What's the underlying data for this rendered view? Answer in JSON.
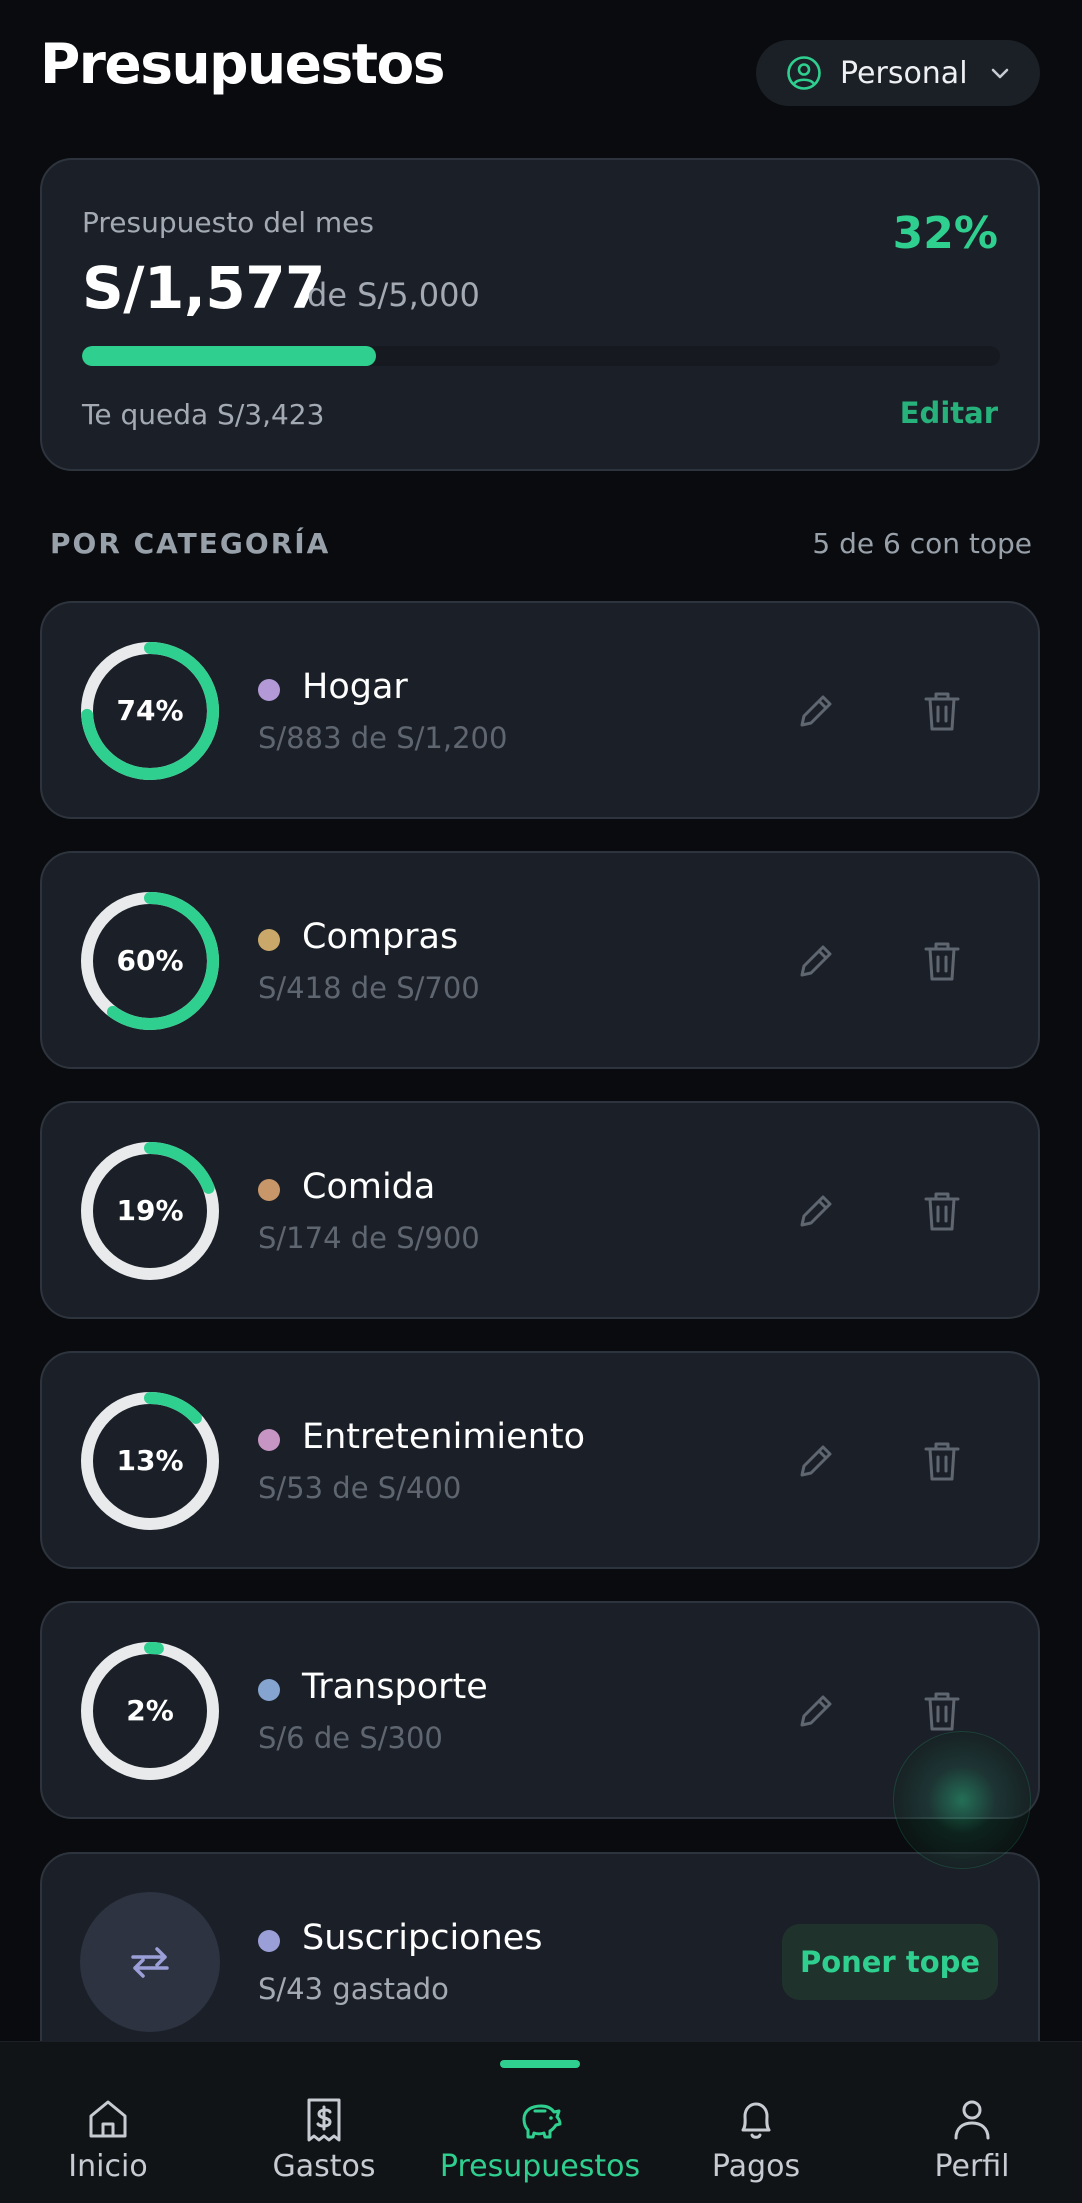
{
  "header": {
    "title": "Presupuestos",
    "account": "Personal"
  },
  "summary": {
    "label": "Presupuesto del mes",
    "amount": "S/1,577",
    "of": "de S/5,000",
    "percent_label": "32%",
    "progress": 0.32,
    "remaining": "Te queda S/3,423",
    "edit_label": "Editar"
  },
  "section": {
    "title": "POR CATEGORÍA",
    "count": "5 de 6 con tope"
  },
  "categories": [
    {
      "name": "Hogar",
      "sub": "S/883 de S/1,200",
      "percent_label": "74%",
      "progress": 0.74,
      "color": "#b39ad6"
    },
    {
      "name": "Compras",
      "sub": "S/418 de S/700",
      "percent_label": "60%",
      "progress": 0.6,
      "color": "#c9a86a"
    },
    {
      "name": "Comida",
      "sub": "S/174 de S/900",
      "percent_label": "19%",
      "progress": 0.19,
      "color": "#c79669"
    },
    {
      "name": "Entretenimiento",
      "sub": "S/53 de S/400",
      "percent_label": "13%",
      "progress": 0.13,
      "color": "#c795c4"
    },
    {
      "name": "Transporte",
      "sub": "S/6 de S/300",
      "percent_label": "2%",
      "progress": 0.02,
      "color": "#85a4cf"
    }
  ],
  "subscription": {
    "name": "Suscripciones",
    "sub": "S/43 gastado",
    "button": "Poner tope",
    "color": "#9b9fd8"
  },
  "tabs": [
    {
      "label": "Inicio",
      "icon": "home-icon"
    },
    {
      "label": "Gastos",
      "icon": "receipt-icon"
    },
    {
      "label": "Presupuestos",
      "icon": "piggy-bank-icon",
      "active": true
    },
    {
      "label": "Pagos",
      "icon": "bell-icon"
    },
    {
      "label": "Perfil",
      "icon": "user-icon"
    }
  ],
  "colors": {
    "accent": "#2fd08f",
    "background": "#090b0e",
    "card": "#1b2028"
  }
}
